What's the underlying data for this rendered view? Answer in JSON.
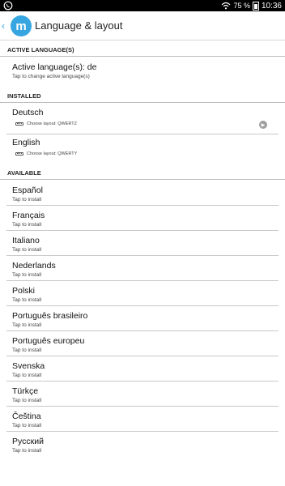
{
  "status_bar": {
    "battery_percent": "75 %",
    "time": "10:36",
    "left_icon": "whatsapp-icon",
    "right_icons": [
      "wifi-icon",
      "battery-icon"
    ]
  },
  "action_bar": {
    "title": "Language & layout",
    "logo_letter": "m",
    "back_icon": "chevron-left-icon"
  },
  "sections": {
    "active": {
      "header": "ACTIVE LANGUAGE(S)",
      "title": "Active language(s): de",
      "subtitle": "Tap to change active language(s)"
    },
    "installed": {
      "header": "INSTALLED",
      "items": [
        {
          "title": "Deutsch",
          "layout": "Choose layout: QWERTZ",
          "has_arrow": true
        },
        {
          "title": "English",
          "layout": "Choose layout: QWERTY",
          "has_arrow": false
        }
      ]
    },
    "available": {
      "header": "AVAILABLE",
      "install_hint": "Tap to install",
      "items": [
        {
          "title": "Español",
          "subtitle": "Tap to install"
        },
        {
          "title": "Français",
          "subtitle": "Tap to install"
        },
        {
          "title": "Italiano",
          "subtitle": "Tap to install"
        },
        {
          "title": "Nederlands",
          "subtitle": "Tap to install"
        },
        {
          "title": "Polski",
          "subtitle": "Tap to install"
        },
        {
          "title": "Português brasileiro",
          "subtitle": "Tap to install"
        },
        {
          "title": "Português europeu",
          "subtitle": "Tap to install"
        },
        {
          "title": "Svenska",
          "subtitle": "Tap to install"
        },
        {
          "title": "Türkçe",
          "subtitle": "Tap to install"
        },
        {
          "title": "Čeština",
          "subtitle": "Tap to install"
        },
        {
          "title": "Русский",
          "subtitle": "Tap to install"
        }
      ]
    }
  },
  "colors": {
    "accent": "#37a6e0",
    "status_bar_bg": "#000000",
    "divider": "#c8c8c8"
  }
}
